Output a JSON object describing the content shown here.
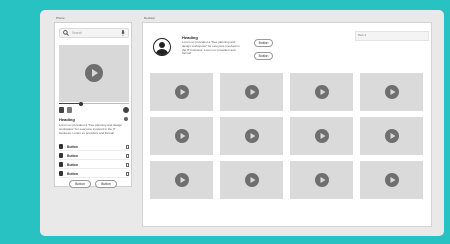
{
  "frames": {
    "phone_label": "Phone",
    "desktop_label": "Desktop"
  },
  "phone": {
    "search": {
      "placeholder": "Search"
    },
    "video": {
      "progress": 0.32
    },
    "content": {
      "heading": "Heading",
      "body": "Lorem ex provident a \"free planning and design workspace\" for everyone involved in the IT business. Lorem ex provident and format!"
    },
    "list": [
      {
        "label": "Button"
      },
      {
        "label": "Button"
      },
      {
        "label": "Button"
      },
      {
        "label": "Button"
      }
    ],
    "buttons": [
      "Button",
      "Button"
    ]
  },
  "desktop": {
    "profile": {
      "heading": "Heading",
      "body": "Lorem ex provident a \"free planning and design workspace\" for everyone involved in the IT business. Lorem ex provident and format!",
      "buttons": [
        "Button",
        "Button"
      ]
    },
    "text_box": "Text 1",
    "grid": {
      "rows": 3,
      "cols": 4
    }
  },
  "icons": {
    "search": "search-icon",
    "mic": "microphone-icon",
    "play": "play-icon",
    "avatar": "user-avatar-icon",
    "trash": "trash-icon"
  },
  "colors": {
    "background": "#28c2c2",
    "board": "#e9e9e9",
    "placeholder": "#d8d8d8",
    "play": "#6f6f6f"
  }
}
